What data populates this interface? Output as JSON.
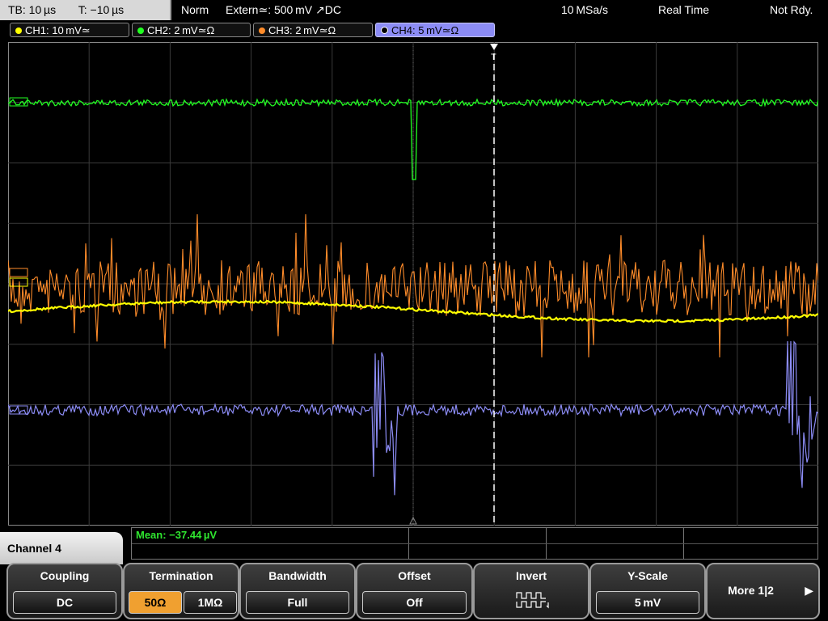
{
  "topbar": {
    "timebase": "TB: 10 µs",
    "trigger_time": "T: −10 µs",
    "mode": "Norm",
    "trigger_source": "Extern≃: 500 mV ↗DC",
    "sample_rate": "10 MSa/s",
    "acq_mode": "Real Time",
    "status": "Not Rdy."
  },
  "channels": [
    {
      "label": "CH1: 10 mV≃",
      "color": "#ffff00"
    },
    {
      "label": "CH2: 2 mV≃Ω",
      "color": "#22ff22"
    },
    {
      "label": "CH3: 2 mV≃Ω",
      "color": "#ff8c2a"
    },
    {
      "label": "CH4: 5 mV≃Ω",
      "color": "#8c8cf5"
    }
  ],
  "measurement": {
    "text": "Mean: −37.44 µV"
  },
  "menu": {
    "title": "Channel 4",
    "coupling": {
      "label": "Coupling",
      "value": "DC"
    },
    "termination": {
      "label": "Termination",
      "opt1": "50Ω",
      "opt2": "1MΩ"
    },
    "bandwidth": {
      "label": "Bandwidth",
      "value": "Full"
    },
    "offset": {
      "label": "Offset",
      "value": "Off"
    },
    "invert": {
      "label": "Invert",
      "icon": "invert-waveform-icon"
    },
    "yscale": {
      "label": "Y-Scale",
      "value": "5 mV"
    },
    "more": {
      "label": "More 1|2"
    }
  },
  "colors": {
    "ch1": "#ffff00",
    "ch2": "#22ff22",
    "ch3": "#ff8c2a",
    "ch4": "#8c8cf5",
    "active_key": "#f0a030",
    "grid": "#3a3a3a"
  }
}
